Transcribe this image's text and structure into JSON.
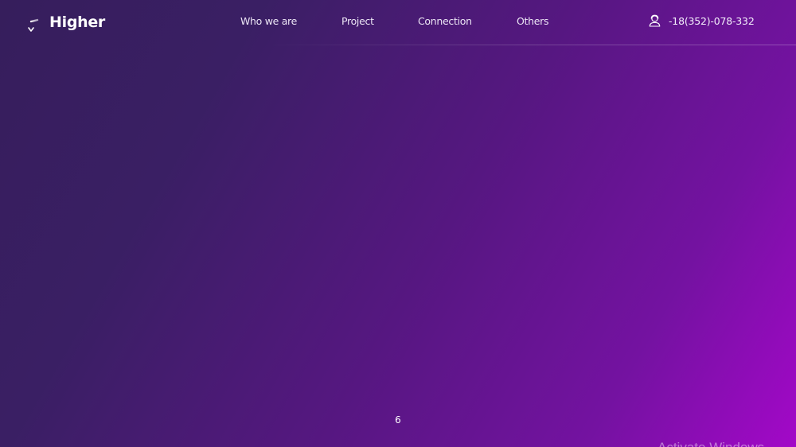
{
  "brand": {
    "name": "Higher",
    "icon": "higher-logo-icon"
  },
  "nav": {
    "items": [
      {
        "label": "Who we are"
      },
      {
        "label": "Project"
      },
      {
        "label": "Connection"
      },
      {
        "label": "Others"
      }
    ]
  },
  "contact": {
    "icon": "user-headset-icon",
    "phone": "-18(352)-078-332"
  },
  "hero": {
    "page_number": "6"
  },
  "system_overlay": {
    "watermark": "Activate Windows"
  },
  "colors": {
    "gradient_start": "#361e5c",
    "gradient_mid": "#561781",
    "gradient_end": "#a308c8",
    "text": "#ffffff"
  }
}
